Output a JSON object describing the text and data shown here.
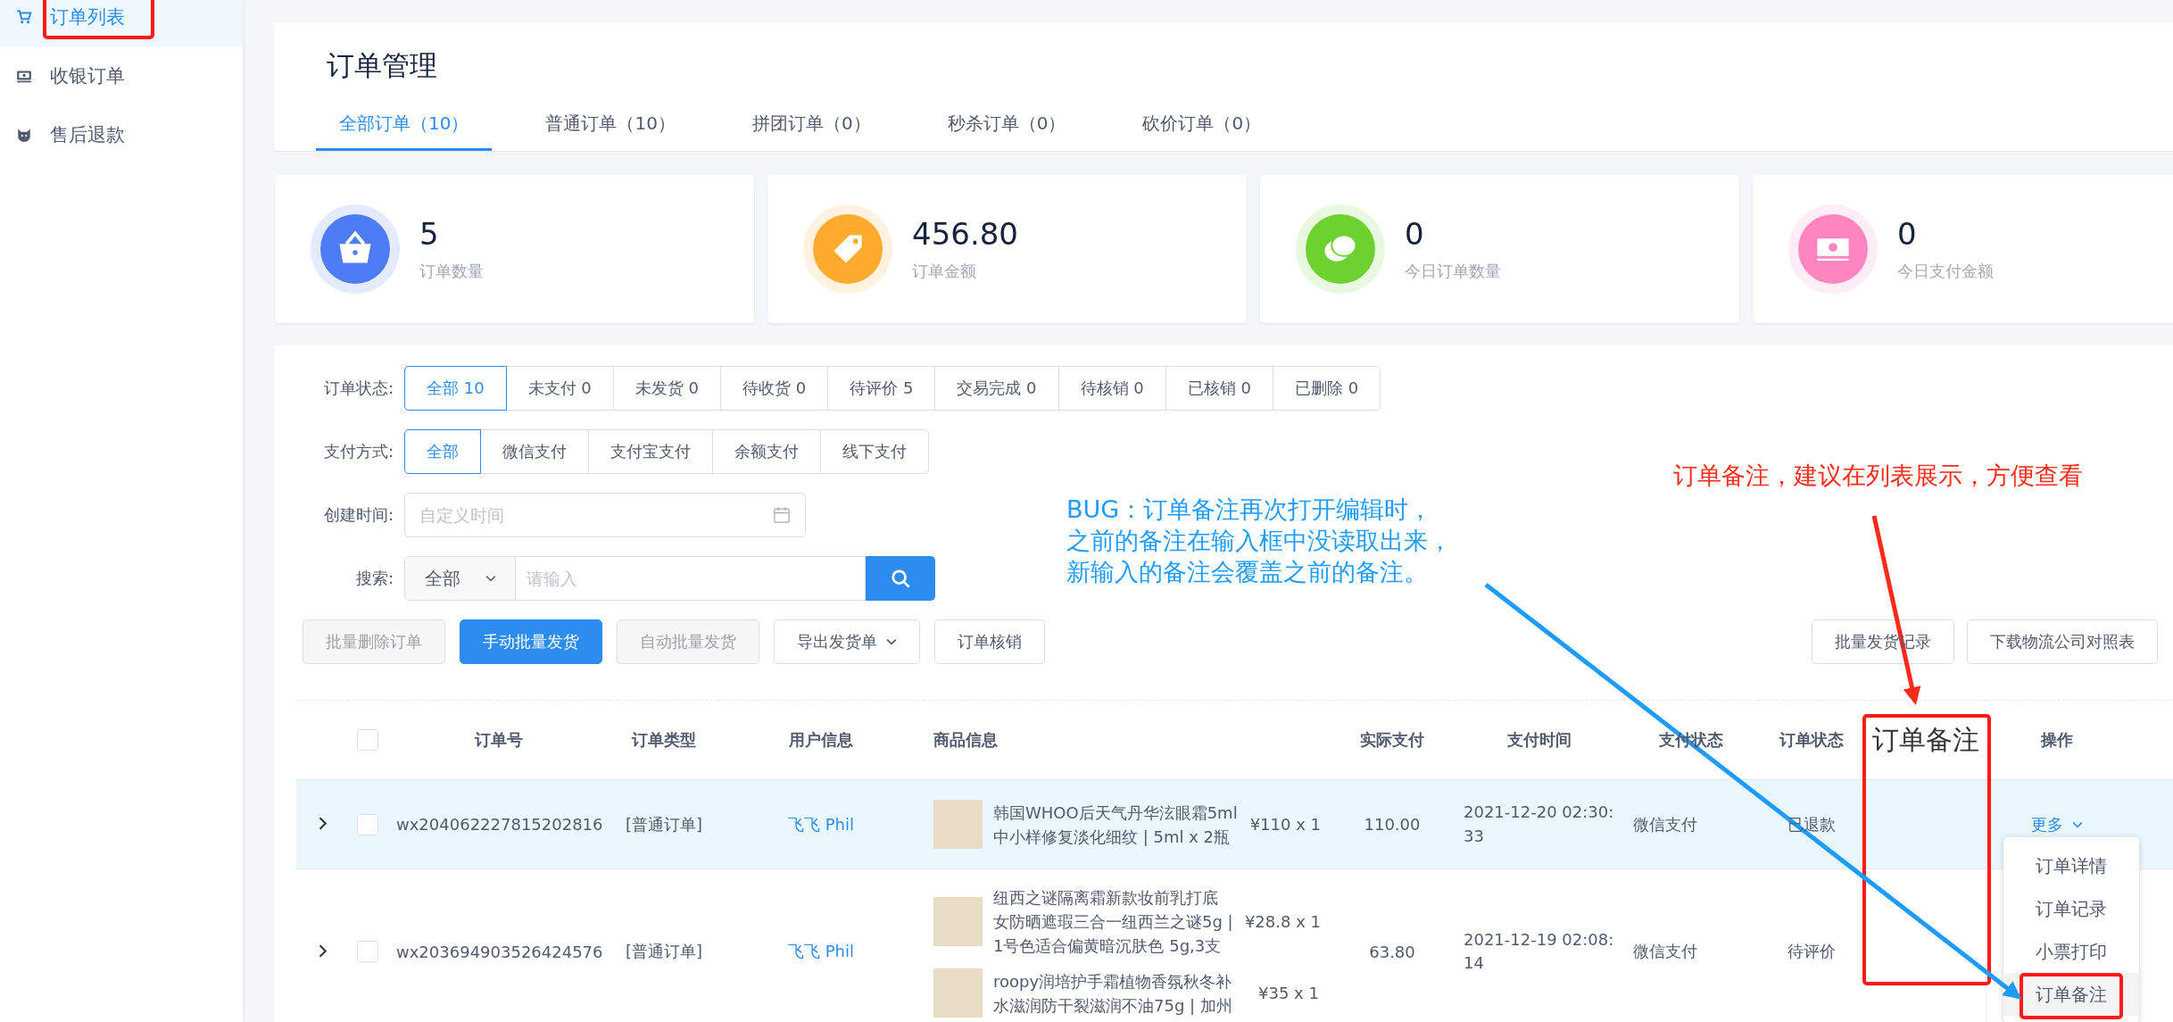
{
  "sidebar": {
    "items": [
      {
        "label": "订单列表",
        "kind": "cart",
        "selected": true
      },
      {
        "label": "收银订单",
        "kind": "register",
        "selected": false
      },
      {
        "label": "售后退款",
        "kind": "cat",
        "selected": false
      }
    ]
  },
  "page_title": "订单管理",
  "tabs": [
    {
      "label": "全部订单（10）",
      "selected": true
    },
    {
      "label": "普通订单（10）",
      "selected": false
    },
    {
      "label": "拼团订单（0）",
      "selected": false
    },
    {
      "label": "秒杀订单（0）",
      "selected": false
    },
    {
      "label": "砍价订单（0）",
      "selected": false
    }
  ],
  "stats": [
    {
      "value": "5",
      "label": "订单数量",
      "kind": "basket",
      "color": "#4e7cf6"
    },
    {
      "value": "456.80",
      "label": "订单金额",
      "kind": "tag",
      "color": "#ffab2e"
    },
    {
      "value": "0",
      "label": "今日订单数量",
      "kind": "chat",
      "color": "#6dd230"
    },
    {
      "value": "0",
      "label": "今日支付金额",
      "kind": "money",
      "color": "#ff85c0"
    }
  ],
  "filters": {
    "status": {
      "label": "订单状态:",
      "options": [
        {
          "label": "全部 10",
          "selected": true
        },
        {
          "label": "未支付 0",
          "selected": false
        },
        {
          "label": "未发货 0",
          "selected": false
        },
        {
          "label": "待收货 0",
          "selected": false
        },
        {
          "label": "待评价 5",
          "selected": false
        },
        {
          "label": "交易完成 0",
          "selected": false
        },
        {
          "label": "待核销 0",
          "selected": false
        },
        {
          "label": "已核销 0",
          "selected": false
        },
        {
          "label": "已删除 0",
          "selected": false
        }
      ]
    },
    "payment": {
      "label": "支付方式:",
      "options": [
        {
          "label": "全部",
          "selected": true
        },
        {
          "label": "微信支付",
          "selected": false
        },
        {
          "label": "支付宝支付",
          "selected": false
        },
        {
          "label": "余额支付",
          "selected": false
        },
        {
          "label": "线下支付",
          "selected": false
        }
      ]
    },
    "created": {
      "label": "创建时间:",
      "placeholder": "自定义时间"
    },
    "search": {
      "label": "搜索:",
      "scope": "全部",
      "placeholder": "请输入"
    }
  },
  "actions": [
    {
      "label": "批量删除订单",
      "primary": false,
      "disabled": true,
      "dropdown": false
    },
    {
      "label": "手动批量发货",
      "primary": true,
      "disabled": false,
      "dropdown": false
    },
    {
      "label": "自动批量发货",
      "primary": false,
      "disabled": true,
      "dropdown": false
    },
    {
      "label": "导出发货单",
      "primary": false,
      "disabled": false,
      "dropdown": true
    },
    {
      "label": "订单核销",
      "primary": false,
      "disabled": false,
      "dropdown": false
    }
  ],
  "right_actions": [
    "批量发货记录",
    "下载物流公司对照表"
  ],
  "table": {
    "select_all_checked": false,
    "columns": [
      {
        "label": "订单号",
        "kind": "header"
      },
      {
        "label": "订单类型",
        "kind": "header"
      },
      {
        "label": "用户信息",
        "kind": "header"
      },
      {
        "label": "商品信息",
        "kind": "header"
      },
      {
        "label": "实际支付",
        "kind": "header"
      },
      {
        "label": "支付时间",
        "kind": "header"
      },
      {
        "label": "支付状态",
        "kind": "header"
      },
      {
        "label": "订单状态",
        "kind": "header"
      },
      {
        "label": "订单备注",
        "kind": "annotation"
      },
      {
        "label": "操作",
        "kind": "header"
      }
    ],
    "rows": [
      {
        "expanded": false,
        "checked": false,
        "highlighted": true,
        "order_no": "wx204062227815202816",
        "type": "[普通订单]",
        "user": "飞飞 Phil",
        "goods": [
          {
            "name": "韩国WHOO后天气丹华泫眼霜5ml中小样修复淡化细纹 | 5ml x 2瓶",
            "price": "¥110 x 1"
          }
        ],
        "paid": "110.00",
        "pay_time": "2021-12-20 02:30:33",
        "pay_status": "微信支付",
        "status": "已退款",
        "action": "更多"
      },
      {
        "expanded": false,
        "checked": false,
        "highlighted": false,
        "order_no": "wx203694903526424576",
        "type": "[普通订单]",
        "user": "飞飞 Phil",
        "goods": [
          {
            "name": "纽西之谜隔离霜新款妆前乳打底女防晒遮瑕三合一纽西兰之谜5g | 1号色适合偏黄暗沉肤色 5g,3支",
            "price": "¥28.8 x 1"
          },
          {
            "name": "roopy润培护手霜植物香氛秋冬补水滋润防干裂滋润不油75g | 加州",
            "price": "¥35 x 1"
          }
        ],
        "paid": "63.80",
        "pay_time": "2021-12-19 02:08:14",
        "pay_status": "微信支付",
        "status": "待评价"
      }
    ]
  },
  "menu": {
    "items": [
      {
        "label": "订单详情",
        "selected": false
      },
      {
        "label": "订单记录",
        "selected": false
      },
      {
        "label": "小票打印",
        "selected": false
      },
      {
        "label": "订单备注",
        "selected": true
      }
    ]
  },
  "annotations": {
    "bug_note": [
      "BUG：订单备注再次打开编辑时，",
      "之前的备注在输入框中没读取出来，",
      "新输入的备注会覆盖之前的备注。"
    ],
    "suggestion_note": "订单备注，建议在列表展示，方便查看"
  }
}
